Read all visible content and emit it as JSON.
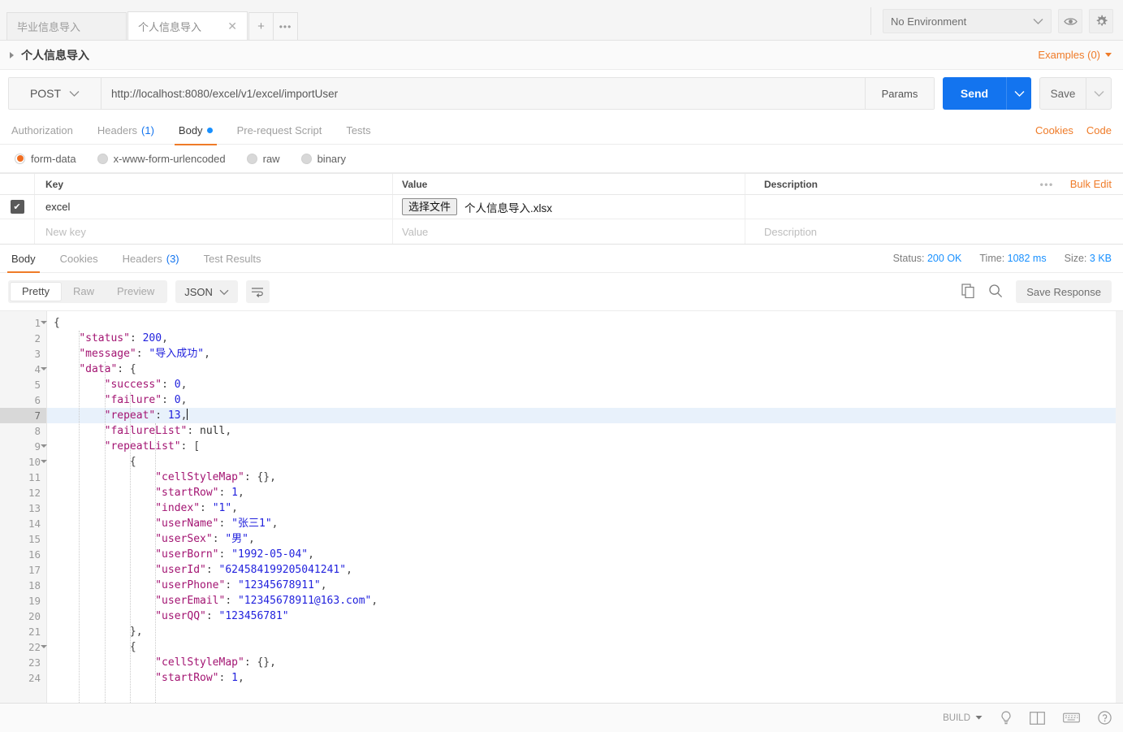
{
  "window": {
    "tabs": [
      {
        "label": "毕业信息导入",
        "active": false,
        "closable": false
      },
      {
        "label": "个人信息导入",
        "active": true,
        "closable": true
      }
    ],
    "new_tab_label": "+",
    "tab_overflow_label": "•••",
    "environment": {
      "selected": "No Environment",
      "eye_icon": "eye-icon",
      "gear_icon": "gear-icon"
    }
  },
  "request": {
    "name": "个人信息导入",
    "examples_label": "Examples (0)",
    "method": "POST",
    "url": "http://localhost:8080/excel/v1/excel/importUser",
    "params_label": "Params",
    "send_label": "Send",
    "save_label": "Save",
    "tabs": [
      {
        "label": "Authorization",
        "badge": "",
        "active": false,
        "dot": false
      },
      {
        "label": "Headers",
        "badge": "(1)",
        "active": false,
        "dot": false
      },
      {
        "label": "Body",
        "badge": "",
        "active": true,
        "dot": true
      },
      {
        "label": "Pre-request Script",
        "badge": "",
        "active": false,
        "dot": false
      },
      {
        "label": "Tests",
        "badge": "",
        "active": false,
        "dot": false
      }
    ],
    "links": {
      "cookies": "Cookies",
      "code": "Code"
    },
    "body_types": [
      {
        "label": "form-data",
        "selected": true
      },
      {
        "label": "x-www-form-urlencoded",
        "selected": false
      },
      {
        "label": "raw",
        "selected": false
      },
      {
        "label": "binary",
        "selected": false
      }
    ],
    "form_table": {
      "headers": {
        "key": "Key",
        "value": "Value",
        "description": "Description"
      },
      "dots_label": "•••",
      "bulk_edit_label": "Bulk Edit",
      "rows": [
        {
          "checked": true,
          "key": "excel",
          "value_type": "file",
          "file_button_label": "选择文件",
          "file_name": "个人信息导入.xlsx",
          "description": ""
        },
        {
          "checked": false,
          "key": "",
          "key_placeholder": "New key",
          "value_type": "text",
          "value": "",
          "value_placeholder": "Value",
          "description": "",
          "description_placeholder": "Description"
        }
      ]
    }
  },
  "response": {
    "tabs": [
      {
        "label": "Body",
        "badge": "",
        "active": true
      },
      {
        "label": "Cookies",
        "badge": "",
        "active": false
      },
      {
        "label": "Headers",
        "badge": "(3)",
        "active": false
      },
      {
        "label": "Test Results",
        "badge": "",
        "active": false
      }
    ],
    "meta": {
      "status_label": "Status:",
      "status_value": "200 OK",
      "time_label": "Time:",
      "time_value": "1082 ms",
      "size_label": "Size:",
      "size_value": "3 KB"
    },
    "view_modes": [
      {
        "label": "Pretty",
        "active": true
      },
      {
        "label": "Raw",
        "active": false
      },
      {
        "label": "Preview",
        "active": false
      }
    ],
    "format": "JSON",
    "wrap_icon": "word-wrap-icon",
    "copy_icon": "copy-icon",
    "search_icon": "search-icon",
    "save_response_label": "Save Response",
    "highlighted_line": 7,
    "body_lines": [
      {
        "n": 1,
        "fold": true,
        "indent": 0,
        "tokens": [
          {
            "t": "p",
            "v": "{"
          }
        ]
      },
      {
        "n": 2,
        "fold": false,
        "indent": 1,
        "tokens": [
          {
            "t": "k",
            "v": "\"status\""
          },
          {
            "t": "p",
            "v": ": "
          },
          {
            "t": "n",
            "v": "200"
          },
          {
            "t": "p",
            "v": ","
          }
        ]
      },
      {
        "n": 3,
        "fold": false,
        "indent": 1,
        "tokens": [
          {
            "t": "k",
            "v": "\"message\""
          },
          {
            "t": "p",
            "v": ": "
          },
          {
            "t": "s",
            "v": "\"导入成功\""
          },
          {
            "t": "p",
            "v": ","
          }
        ]
      },
      {
        "n": 4,
        "fold": true,
        "indent": 1,
        "tokens": [
          {
            "t": "k",
            "v": "\"data\""
          },
          {
            "t": "p",
            "v": ": {"
          }
        ]
      },
      {
        "n": 5,
        "fold": false,
        "indent": 2,
        "tokens": [
          {
            "t": "k",
            "v": "\"success\""
          },
          {
            "t": "p",
            "v": ": "
          },
          {
            "t": "n",
            "v": "0"
          },
          {
            "t": "p",
            "v": ","
          }
        ]
      },
      {
        "n": 6,
        "fold": false,
        "indent": 2,
        "tokens": [
          {
            "t": "k",
            "v": "\"failure\""
          },
          {
            "t": "p",
            "v": ": "
          },
          {
            "t": "n",
            "v": "0"
          },
          {
            "t": "p",
            "v": ","
          }
        ]
      },
      {
        "n": 7,
        "fold": false,
        "indent": 2,
        "tokens": [
          {
            "t": "k",
            "v": "\"repeat\""
          },
          {
            "t": "p",
            "v": ": "
          },
          {
            "t": "n",
            "v": "13"
          },
          {
            "t": "p",
            "v": ","
          }
        ],
        "caret": true
      },
      {
        "n": 8,
        "fold": false,
        "indent": 2,
        "tokens": [
          {
            "t": "k",
            "v": "\"failureList\""
          },
          {
            "t": "p",
            "v": ": "
          },
          {
            "t": "nul",
            "v": "null"
          },
          {
            "t": "p",
            "v": ","
          }
        ]
      },
      {
        "n": 9,
        "fold": true,
        "indent": 2,
        "tokens": [
          {
            "t": "k",
            "v": "\"repeatList\""
          },
          {
            "t": "p",
            "v": ": ["
          }
        ]
      },
      {
        "n": 10,
        "fold": true,
        "indent": 3,
        "tokens": [
          {
            "t": "p",
            "v": "{"
          }
        ]
      },
      {
        "n": 11,
        "fold": false,
        "indent": 4,
        "tokens": [
          {
            "t": "k",
            "v": "\"cellStyleMap\""
          },
          {
            "t": "p",
            "v": ": {},"
          }
        ]
      },
      {
        "n": 12,
        "fold": false,
        "indent": 4,
        "tokens": [
          {
            "t": "k",
            "v": "\"startRow\""
          },
          {
            "t": "p",
            "v": ": "
          },
          {
            "t": "n",
            "v": "1"
          },
          {
            "t": "p",
            "v": ","
          }
        ]
      },
      {
        "n": 13,
        "fold": false,
        "indent": 4,
        "tokens": [
          {
            "t": "k",
            "v": "\"index\""
          },
          {
            "t": "p",
            "v": ": "
          },
          {
            "t": "s",
            "v": "\"1\""
          },
          {
            "t": "p",
            "v": ","
          }
        ]
      },
      {
        "n": 14,
        "fold": false,
        "indent": 4,
        "tokens": [
          {
            "t": "k",
            "v": "\"userName\""
          },
          {
            "t": "p",
            "v": ": "
          },
          {
            "t": "s",
            "v": "\"张三1\""
          },
          {
            "t": "p",
            "v": ","
          }
        ]
      },
      {
        "n": 15,
        "fold": false,
        "indent": 4,
        "tokens": [
          {
            "t": "k",
            "v": "\"userSex\""
          },
          {
            "t": "p",
            "v": ": "
          },
          {
            "t": "s",
            "v": "\"男\""
          },
          {
            "t": "p",
            "v": ","
          }
        ]
      },
      {
        "n": 16,
        "fold": false,
        "indent": 4,
        "tokens": [
          {
            "t": "k",
            "v": "\"userBorn\""
          },
          {
            "t": "p",
            "v": ": "
          },
          {
            "t": "s",
            "v": "\"1992-05-04\""
          },
          {
            "t": "p",
            "v": ","
          }
        ]
      },
      {
        "n": 17,
        "fold": false,
        "indent": 4,
        "tokens": [
          {
            "t": "k",
            "v": "\"userId\""
          },
          {
            "t": "p",
            "v": ": "
          },
          {
            "t": "s",
            "v": "\"624584199205041241\""
          },
          {
            "t": "p",
            "v": ","
          }
        ]
      },
      {
        "n": 18,
        "fold": false,
        "indent": 4,
        "tokens": [
          {
            "t": "k",
            "v": "\"userPhone\""
          },
          {
            "t": "p",
            "v": ": "
          },
          {
            "t": "s",
            "v": "\"12345678911\""
          },
          {
            "t": "p",
            "v": ","
          }
        ]
      },
      {
        "n": 19,
        "fold": false,
        "indent": 4,
        "tokens": [
          {
            "t": "k",
            "v": "\"userEmail\""
          },
          {
            "t": "p",
            "v": ": "
          },
          {
            "t": "s",
            "v": "\"12345678911@163.com\""
          },
          {
            "t": "p",
            "v": ","
          }
        ]
      },
      {
        "n": 20,
        "fold": false,
        "indent": 4,
        "tokens": [
          {
            "t": "k",
            "v": "\"userQQ\""
          },
          {
            "t": "p",
            "v": ": "
          },
          {
            "t": "s",
            "v": "\"123456781\""
          }
        ]
      },
      {
        "n": 21,
        "fold": false,
        "indent": 3,
        "tokens": [
          {
            "t": "p",
            "v": "},"
          }
        ]
      },
      {
        "n": 22,
        "fold": true,
        "indent": 3,
        "tokens": [
          {
            "t": "p",
            "v": "{"
          }
        ]
      },
      {
        "n": 23,
        "fold": false,
        "indent": 4,
        "tokens": [
          {
            "t": "k",
            "v": "\"cellStyleMap\""
          },
          {
            "t": "p",
            "v": ": {},"
          }
        ]
      },
      {
        "n": 24,
        "fold": false,
        "indent": 4,
        "tokens": [
          {
            "t": "k",
            "v": "\"startRow\""
          },
          {
            "t": "p",
            "v": ": "
          },
          {
            "t": "n",
            "v": "1"
          },
          {
            "t": "p",
            "v": ","
          }
        ]
      }
    ]
  },
  "footer": {
    "build_label": "BUILD",
    "bulb_icon": "lightbulb-icon",
    "layout_icon": "two-pane-layout-icon",
    "keyboard_icon": "keyboard-icon",
    "help_icon": "help-icon"
  },
  "colors": {
    "accent_orange": "#ef7b28",
    "send_blue": "#1374ef",
    "link_blue": "#1890ff",
    "json_key": "#a31472",
    "json_string": "#2222dd"
  }
}
